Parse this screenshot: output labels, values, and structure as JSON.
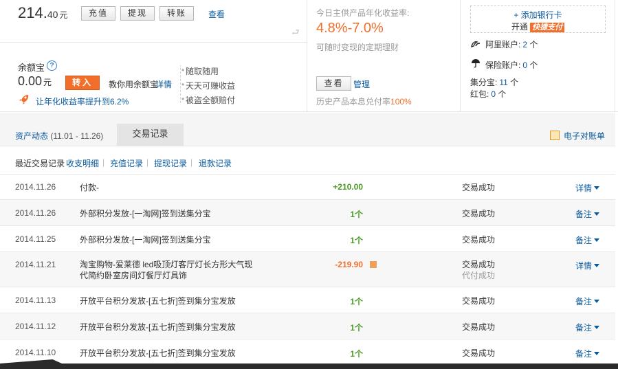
{
  "balance": {
    "int": "214.",
    "dec": "40",
    "unit": "元"
  },
  "balance_buttons": {
    "recharge": "充值",
    "withdraw": "提现",
    "transfer": "转账"
  },
  "balance_view": "查看",
  "yuebao": {
    "title": "余额宝",
    "amount": "0.00",
    "unit": "元",
    "transfer_in": "转入",
    "teach": "教你用余额宝",
    "detail": "详情",
    "boost": "让年化收益率提升到6.2%",
    "features": [
      "随取随用",
      "天天可赚收益",
      "被盗全额赔付"
    ]
  },
  "product": {
    "label": "今日主供产品年化收益率:",
    "rate": "4.8%-7.0%",
    "sub": "可随时变现的定期理财",
    "view": "查看",
    "manage": "管理",
    "history_prefix": "历史产品本息兑付率",
    "history_pct": "100%"
  },
  "accounts": {
    "add_card": "+ 添加银行卡",
    "open": "开通",
    "quick_pay": "快捷支付",
    "ali_label": "阿里账户:",
    "ali_count": "2",
    "insurance_label": "保险账户:",
    "insurance_count": "0",
    "jifen_label": "集分宝:",
    "jifen_count": "11",
    "redpack_label": "红包:",
    "redpack_count": "0",
    "unit": "个"
  },
  "tabs": {
    "assets": "资产动态",
    "assets_range": "(11.01 - 11.26)",
    "trade": "交易记录",
    "statement": "电子对账单"
  },
  "filters": {
    "current": "最近交易记录",
    "items": [
      "收支明细",
      "充值记录",
      "提现记录",
      "退款记录"
    ]
  },
  "transactions": [
    {
      "date": "2014.11.26",
      "name": "付款-",
      "amount": "+210.00",
      "sign": "pos",
      "status": "交易成功",
      "status_sub": "",
      "action": "详情"
    },
    {
      "date": "2014.11.26",
      "name": "外部积分发放-[一淘网]签到送集分宝",
      "amount": "1个",
      "sign": "pos",
      "status": "交易成功",
      "status_sub": "",
      "action": "备注"
    },
    {
      "date": "2014.11.25",
      "name": "外部积分发放-[一淘网]签到送集分宝",
      "amount": "1个",
      "sign": "pos",
      "status": "交易成功",
      "status_sub": "",
      "action": "备注"
    },
    {
      "date": "2014.11.21",
      "name": "淘宝购物-爱莱德 led吸顶灯客厅灯长方形大气现代简约卧室房间灯餐厅灯具饰",
      "amount": "-219.90",
      "sign": "neg",
      "status": "交易成功",
      "status_sub": "代付成功",
      "action": "详情"
    },
    {
      "date": "2014.11.13",
      "name": "开放平台积分发放-[五七折]签到集分宝发放",
      "amount": "1个",
      "sign": "pos",
      "status": "交易成功",
      "status_sub": "",
      "action": "备注"
    },
    {
      "date": "2014.11.12",
      "name": "开放平台积分发放-[五七折]签到集分宝发放",
      "amount": "1个",
      "sign": "pos",
      "status": "交易成功",
      "status_sub": "",
      "action": "备注"
    },
    {
      "date": "2014.11.10",
      "name": "开放平台积分发放-[五七折]签到集分宝发放",
      "amount": "1个",
      "sign": "pos",
      "status": "交易成功",
      "status_sub": "",
      "action": "备注"
    }
  ]
}
